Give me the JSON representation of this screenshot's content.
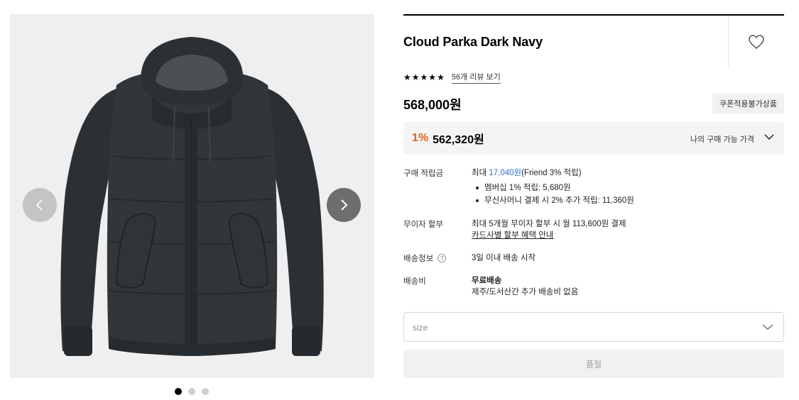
{
  "product": {
    "title": "Cloud Parka Dark Navy",
    "rating_stars": 5,
    "review_link": "56개 리뷰 보기",
    "price": "568,000원",
    "coupon_badge": "쿠폰적용불가상품",
    "discount_rate": "1%",
    "member_price": "562,320원",
    "my_price_label": "나의 구매 가능 가격"
  },
  "gallery": {
    "slide_count": 3,
    "active_slide": 1,
    "prev_icon": "chevron-left-icon",
    "next_icon": "chevron-right-icon"
  },
  "details": {
    "points": {
      "label": "구매 적립금",
      "max_prefix": "최대 ",
      "max_amount": "17,040원",
      "max_suffix": "(Friend 3% 적립)",
      "bullets": [
        "멤버십 1% 적립: 5,680원",
        "무신사머니 결제 시 2% 추가 적립: 11,360원"
      ]
    },
    "installment": {
      "label": "무이자 할부",
      "text": "최대 5개월 무이자 할부 시 월 113,600원 결제",
      "link": "카드사별 할부 혜택 안내"
    },
    "delivery": {
      "label": "배송정보",
      "help_icon": "?",
      "text": "3일 이내 배송 시작"
    },
    "shipping_fee": {
      "label": "배송비",
      "title": "무료배송",
      "text": "제주/도서산간 추가 배송비 없음"
    }
  },
  "size_select": {
    "placeholder": "size"
  },
  "buy_button": {
    "label": "품절"
  },
  "colors": {
    "discount": "#f25a12",
    "points_blue": "#2f6fd6",
    "jacket": "#2b3034"
  }
}
